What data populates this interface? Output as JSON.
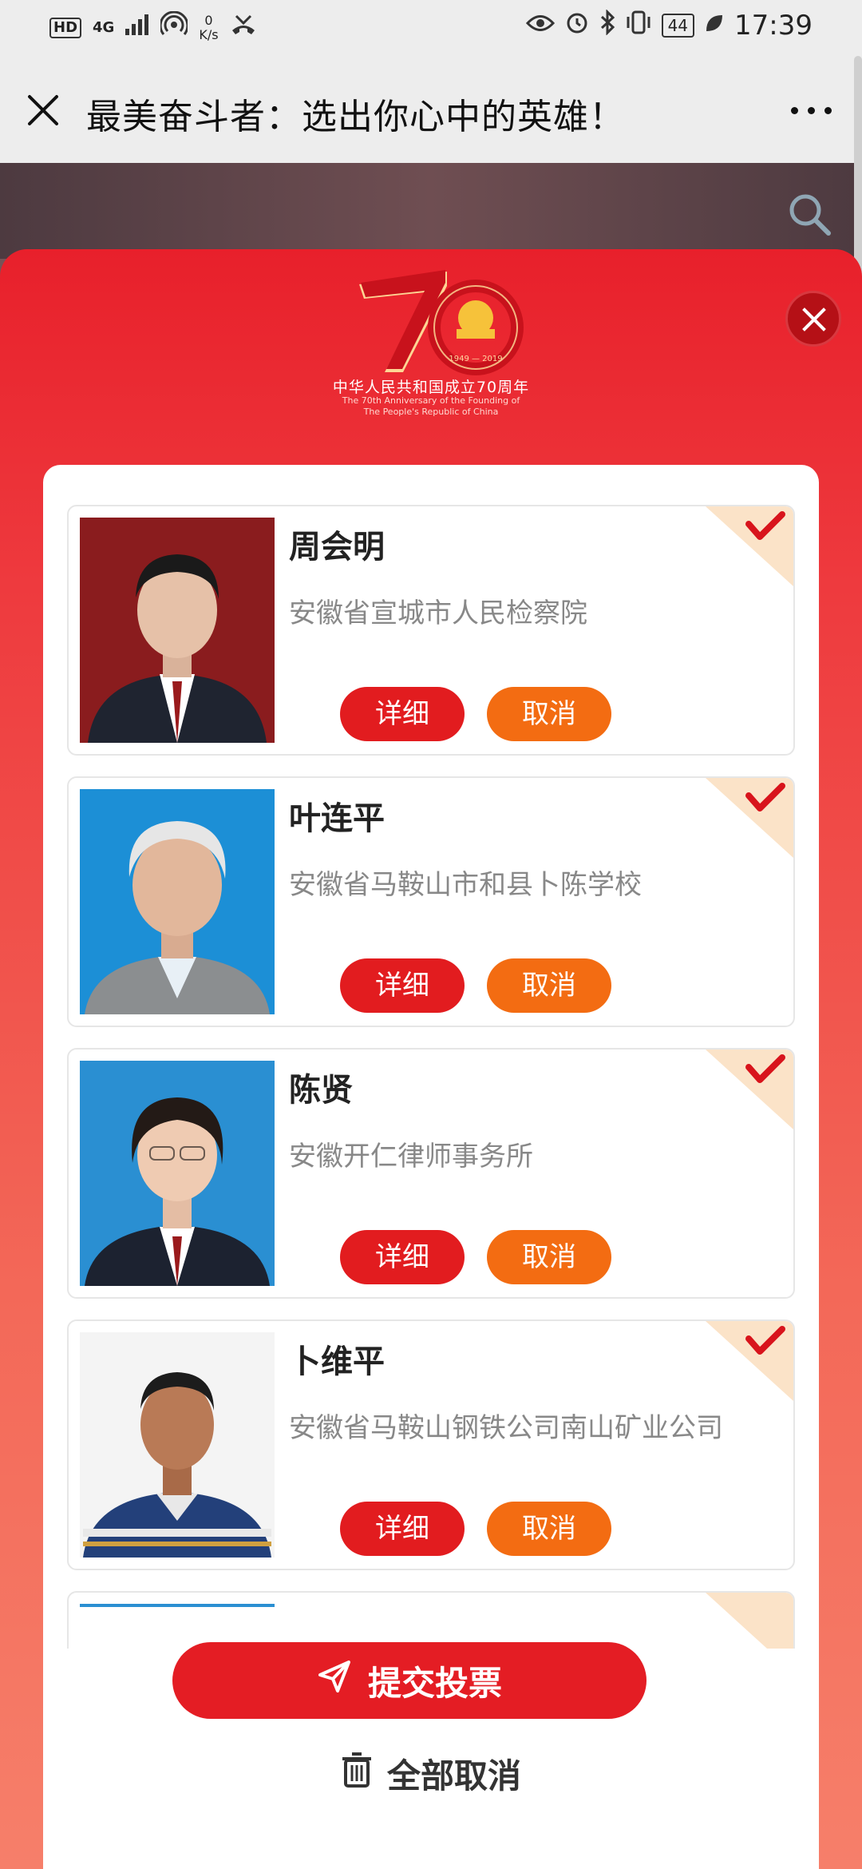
{
  "status_bar": {
    "hd": "HD",
    "net_type": "4G",
    "net_speed_value": "0",
    "net_speed_unit": "K/s",
    "battery": "44",
    "time": "17:39"
  },
  "title_bar": {
    "title": "最美奋斗者：选出你心中的英雄！"
  },
  "emblem": {
    "number": "70",
    "years": "1949 — 2019",
    "cn": "中华人民共和国成立70周年",
    "en_line1": "The 70th Anniversary of the Founding of",
    "en_line2": "The People's Republic of China"
  },
  "candidates": [
    {
      "name": "周会明",
      "org": "安徽省宣城市人民检察院",
      "detail_label": "详细",
      "cancel_label": "取消"
    },
    {
      "name": "叶连平",
      "org": "安徽省马鞍山市和县卜陈学校",
      "detail_label": "详细",
      "cancel_label": "取消"
    },
    {
      "name": "陈贤",
      "org": "安徽开仁律师事务所",
      "detail_label": "详细",
      "cancel_label": "取消"
    },
    {
      "name": "卜维平",
      "org": "安徽省马鞍山钢铁公司南山矿业公司",
      "detail_label": "详细",
      "cancel_label": "取消"
    }
  ],
  "actions": {
    "submit": "提交投票",
    "cancel_all": "全部取消"
  },
  "colors": {
    "accent_red": "#e41d24",
    "cancel_orange": "#f36c12",
    "check_red": "#d8141c"
  }
}
